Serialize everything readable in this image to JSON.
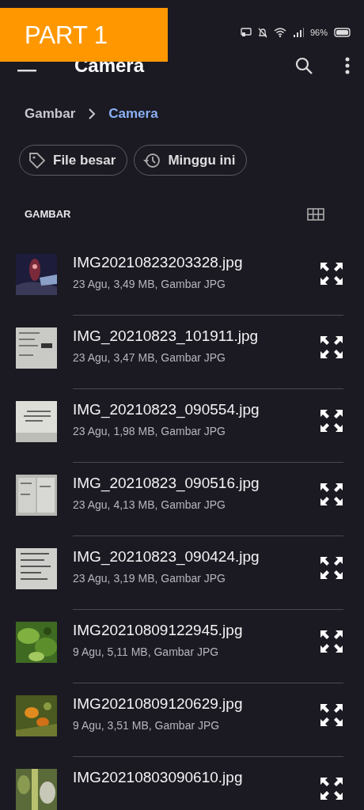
{
  "overlay_banner": {
    "text": "PART 1"
  },
  "status_bar": {
    "battery": "96%"
  },
  "app_bar": {
    "title": "Camera"
  },
  "breadcrumb": [
    {
      "label": "Gambar",
      "selected": false
    },
    {
      "label": "Camera",
      "selected": true
    }
  ],
  "chips": [
    {
      "label": "File besar",
      "kind": "tag"
    },
    {
      "label": "Minggu ini",
      "kind": "history"
    }
  ],
  "section": {
    "title": "GAMBAR"
  },
  "files": [
    {
      "name": "IMG20210823203328.jpg",
      "details": "23 Agu, 3,49 MB, Gambar JPG"
    },
    {
      "name": "IMG_20210823_101911.jpg",
      "details": "23 Agu, 3,47 MB, Gambar JPG"
    },
    {
      "name": "IMG_20210823_090554.jpg",
      "details": "23 Agu, 1,98 MB, Gambar JPG"
    },
    {
      "name": "IMG_20210823_090516.jpg",
      "details": "23 Agu, 4,13 MB, Gambar JPG"
    },
    {
      "name": "IMG_20210823_090424.jpg",
      "details": "23 Agu, 3,19 MB, Gambar JPG"
    },
    {
      "name": "IMG20210809122945.jpg",
      "details": "9 Agu, 5,11 MB, Gambar JPG"
    },
    {
      "name": "IMG20210809120629.jpg",
      "details": "9 Agu, 3,51 MB, Gambar JPG"
    },
    {
      "name": "IMG20210803090610.jpg"
    }
  ]
}
